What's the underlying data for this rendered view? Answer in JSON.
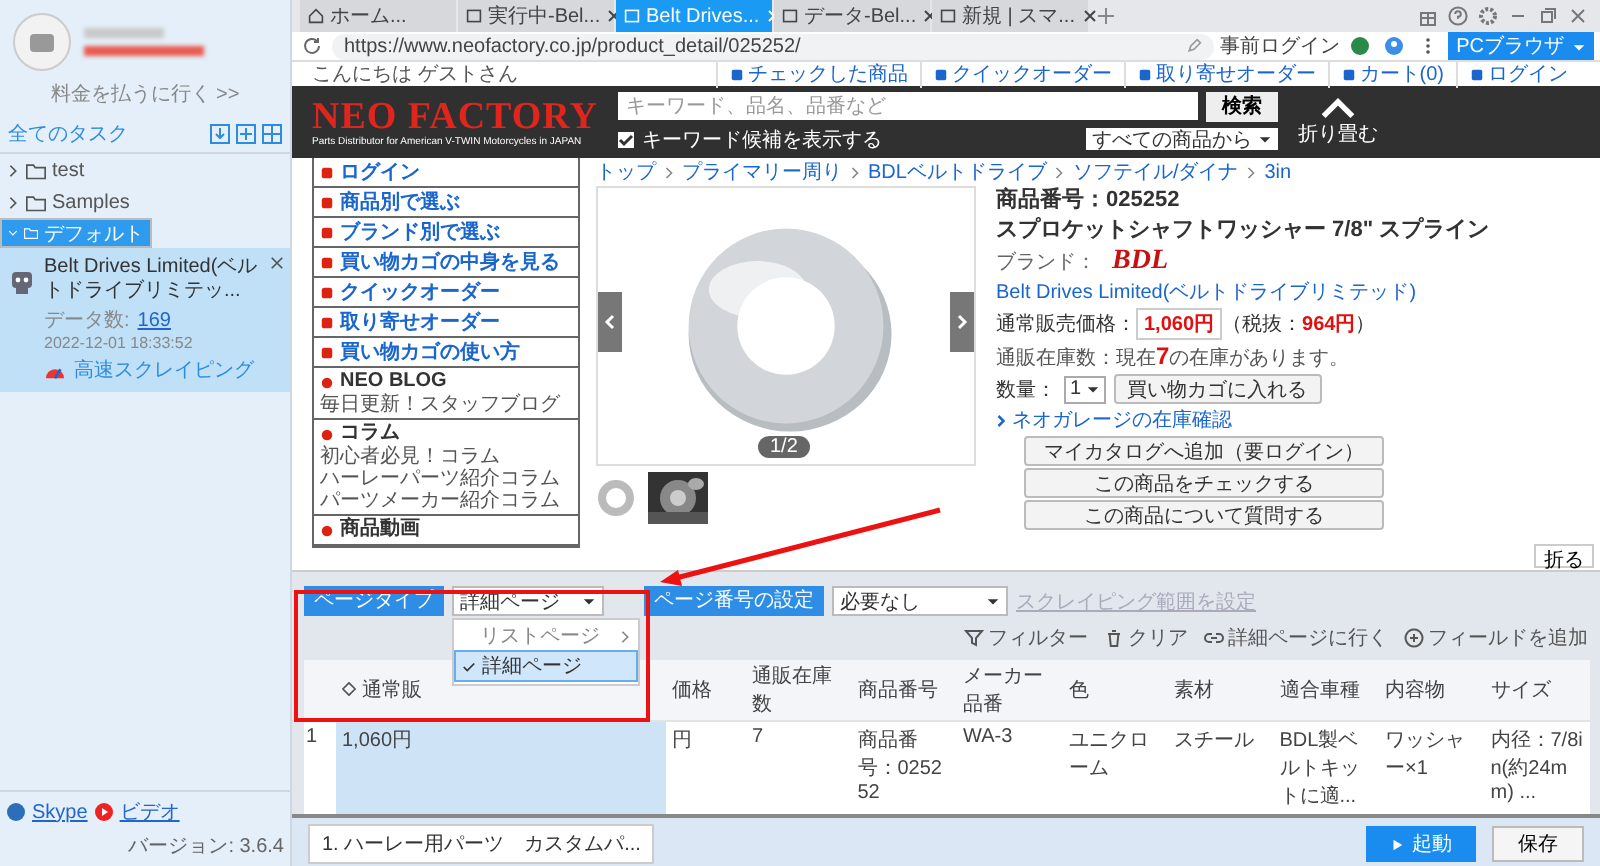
{
  "sidebar": {
    "pay_link": "料金を払うに行く >>",
    "tasks_title": "全てのタスク",
    "tree": [
      {
        "label": "test",
        "expanded": false,
        "selected": false
      },
      {
        "label": "Samples",
        "expanded": false,
        "selected": false
      },
      {
        "label": "デフォルト",
        "expanded": true,
        "selected": true,
        "tasks": [
          {
            "name": "Belt Drives Limited(ベルトドライブリミテッ...",
            "data_label": "データ数:",
            "data_count": "169",
            "time": "2022-12-01 18:33:52",
            "mode": "高速スクレイピング"
          }
        ]
      }
    ],
    "footer": {
      "links": [
        "Skype",
        "ビデオ"
      ],
      "version": "バージョン: 3.6.4"
    }
  },
  "browser": {
    "tabs": [
      {
        "label": "ホーム...",
        "kind": "home",
        "selected": false
      },
      {
        "label": "実行中-Bel...",
        "kind": "page",
        "selected": false
      },
      {
        "label": "Belt Drives...",
        "kind": "page",
        "selected": true
      },
      {
        "label": "データ-Bel...",
        "kind": "page",
        "selected": false
      },
      {
        "label": "新規 | スマ...",
        "kind": "page",
        "selected": false
      }
    ],
    "url": "https://www.neofactory.co.jp/product_detail/025252/",
    "login": "事前ログイン",
    "mode": "PCブラウザ"
  },
  "page": {
    "greeting": "こんにちは ゲストさん",
    "top_links": [
      "チェックした商品",
      "クイックオーダー",
      "取り寄せオーダー",
      "カート(0)",
      "ログイン"
    ],
    "logo": "NEO FACTORY",
    "tagline": "Parts Distributor for American V-TWIN Motorcycles in JAPAN",
    "search": {
      "placeholder": "キーワード、品名、品番など",
      "button": "検索"
    },
    "suggest": {
      "label": "キーワード候補を表示する",
      "checked": true
    },
    "scope": "すべての商品から",
    "fold": "折り畳む",
    "nav": [
      "ログイン",
      "商品別で選ぶ",
      "ブランド別で選ぶ",
      "買い物カゴの中身を見る",
      "クイックオーダー",
      "取り寄せオーダー",
      "買い物カゴの使い方"
    ],
    "nav_sections": [
      {
        "title": "NEO BLOG",
        "lines": [
          "毎日更新！スタッフブログ"
        ]
      },
      {
        "title": "コラム",
        "lines": [
          "初心者必見！コラム",
          "ハーレーパーツ紹介コラム",
          "パーツメーカー紹介コラム"
        ]
      },
      {
        "title": "商品動画"
      }
    ],
    "breadcrumb": [
      "トップ",
      "プライマリー周り",
      "BDLベルトドライブ",
      "ソフテイル/ダイナ",
      "3in"
    ],
    "gallery": {
      "counter": "1/2"
    },
    "product": {
      "code": "商品番号：025252",
      "title": "スプロケットシャフトワッシャー 7/8\" スプライン",
      "brand_label": "ブランド：",
      "brand_logo": "BDL",
      "brand_link": "Belt Drives Limited(ベルトドライブリミテッド)",
      "price_label": "通常販売価格：",
      "price": "1,060円",
      "tax": "（税抜：**964円**）",
      "stock": "通販在庫数：現在**7**の在庫があります。",
      "qty_label": "数量：",
      "qty": "1",
      "cart_button": "買い物カゴに入れる",
      "stock_link": "ネオガレージの在庫確認",
      "buttons": [
        "マイカタログへ追加（要ログイン）",
        "この商品をチェックする",
        "この商品について質問する"
      ]
    },
    "fold_small": "折る"
  },
  "panel": {
    "page_type": {
      "label": "ページタイプ",
      "value": "詳細ページ",
      "options": [
        {
          "label": "リストページ",
          "kind": "submenu",
          "selected": false
        },
        {
          "label": "詳細ページ",
          "kind": "option",
          "selected": true
        }
      ]
    },
    "page_number": {
      "label": "ページ番号の設定",
      "value": "必要なし"
    },
    "range_link": {
      "label": "スクレイピング範囲を設定",
      "disabled": true
    },
    "actions": [
      {
        "label": "フィルター",
        "kind": "filter"
      },
      {
        "label": "クリア",
        "kind": "clear"
      },
      {
        "label": "詳細ページに行く",
        "kind": "goto"
      },
      {
        "label": "フィールドを追加",
        "kind": "add"
      }
    ],
    "table": {
      "columns": [
        "通常販",
        "価格",
        "通販在庫数",
        "商品番号",
        "メーカー品番",
        "色",
        "素材",
        "適合車種",
        "内容物",
        "サイズ"
      ],
      "rows": [
        {
          "index": "1",
          "cells": [
            "1,060円",
            "円",
            "7",
            "商品番号：025252",
            "WA-3",
            "ユニクローム",
            "スチール",
            "BDL製ベルトキットに適...",
            "ワッシャー×1",
            "内径：7/8in(約24mm) ..."
          ]
        }
      ]
    }
  },
  "footer_bar": {
    "task_tab": "1. ハーレー用パーツ　カスタムパ...",
    "run": "起動",
    "save": "保存"
  }
}
